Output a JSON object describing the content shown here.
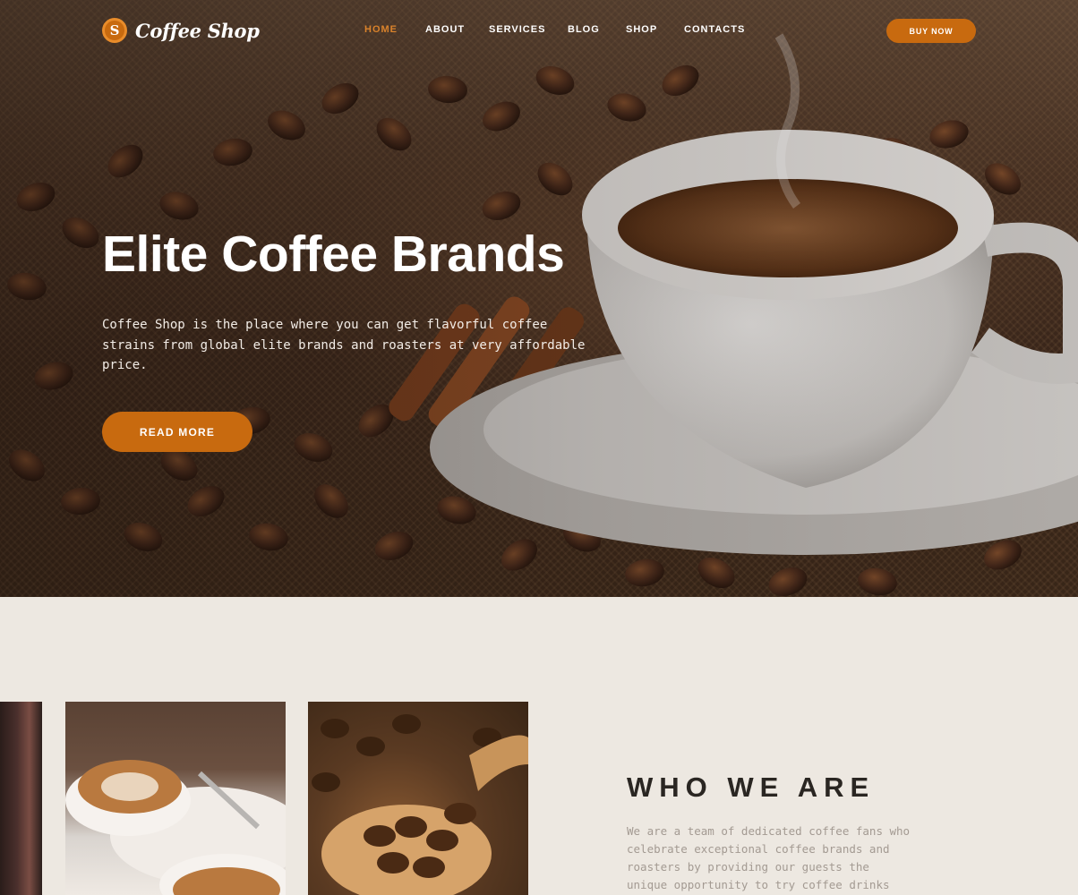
{
  "brand": {
    "name": "Coffee Shop",
    "logo_letter": "S"
  },
  "nav": {
    "items": [
      {
        "label": "HOME",
        "active": true
      },
      {
        "label": "ABOUT",
        "active": false
      },
      {
        "label": "SERVICES",
        "active": false
      },
      {
        "label": "BLOG",
        "active": false
      },
      {
        "label": "SHOP",
        "active": false
      },
      {
        "label": "CONTACTS",
        "active": false
      }
    ],
    "buy_label": "BUY NOW"
  },
  "hero": {
    "title": "Elite Coffee Brands",
    "description": "Coffee Shop is the place where you can get flavorful coffee strains from global elite brands and roasters at very affordable price.",
    "cta_label": "READ MORE"
  },
  "about": {
    "title": "WHO WE ARE",
    "text": "We are a team of dedicated coffee fans who celebrate exceptional coffee brands and roasters by providing our guests the unique opportunity to try coffee drinks"
  },
  "colors": {
    "accent": "#c86a0f",
    "active_nav": "#d9822b",
    "section_bg": "#ede8e1",
    "heading_dark": "#2a2622",
    "muted_text": "#a39a92"
  }
}
